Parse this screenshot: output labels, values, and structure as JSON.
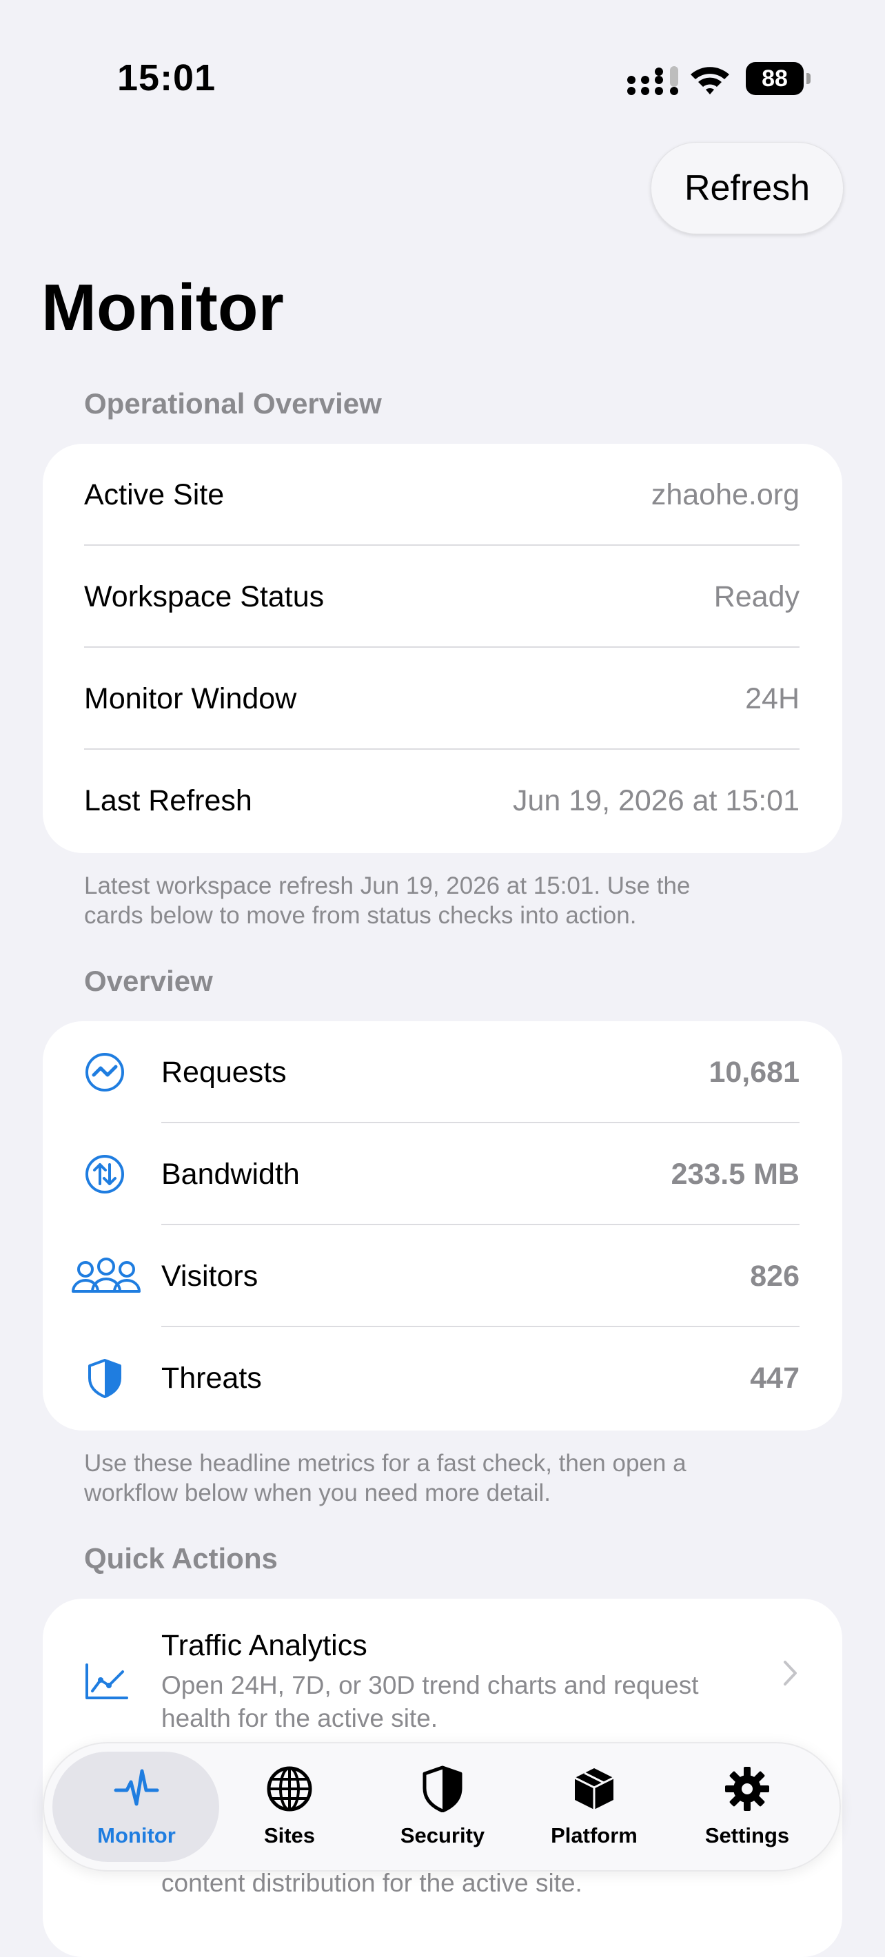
{
  "status_bar": {
    "time": "15:01",
    "battery": "88"
  },
  "header": {
    "refresh_label": "Refresh",
    "title": "Monitor"
  },
  "operational_overview": {
    "header": "Operational Overview",
    "rows": [
      {
        "label": "Active Site",
        "value": "zhaohe.org"
      },
      {
        "label": "Workspace Status",
        "value": "Ready"
      },
      {
        "label": "Monitor Window",
        "value": "24H"
      },
      {
        "label": "Last Refresh",
        "value": "Jun 19, 2026 at 15:01"
      }
    ],
    "footnote_line1": "Latest workspace refresh Jun 19, 2026 at 15:01. Use the",
    "footnote_line2": "cards below to move from status checks into action."
  },
  "overview": {
    "header": "Overview",
    "metrics": [
      {
        "label": "Requests",
        "value": "10,681",
        "icon": "requests-chart-icon"
      },
      {
        "label": "Bandwidth",
        "value": "233.5 MB",
        "icon": "bandwidth-arrows-icon"
      },
      {
        "label": "Visitors",
        "value": "826",
        "icon": "visitors-people-icon"
      },
      {
        "label": "Threats",
        "value": "447",
        "icon": "shield-icon"
      }
    ],
    "footnote_line1": "Use these headline metrics for a fast check, then open a",
    "footnote_line2": "workflow below when you need more detail."
  },
  "quick_actions": {
    "header": "Quick Actions",
    "items": [
      {
        "title": "Traffic Analytics",
        "desc_line1": "Open 24H, 7D, or 30D trend charts and request",
        "desc_line2": "health for the active site.",
        "icon": "line-chart-icon"
      }
    ],
    "partial_desc": "content distribution for the active site."
  },
  "tab_bar": {
    "tabs": [
      {
        "label": "Monitor",
        "icon": "waveform-icon",
        "active": true
      },
      {
        "label": "Sites",
        "icon": "globe-icon"
      },
      {
        "label": "Security",
        "icon": "shield-icon"
      },
      {
        "label": "Platform",
        "icon": "box-icon"
      },
      {
        "label": "Settings",
        "icon": "gear-icon"
      }
    ]
  },
  "colors": {
    "accent": "#1f7de0",
    "background": "#f2f2f7",
    "secondary_text": "#8a8a8e"
  }
}
